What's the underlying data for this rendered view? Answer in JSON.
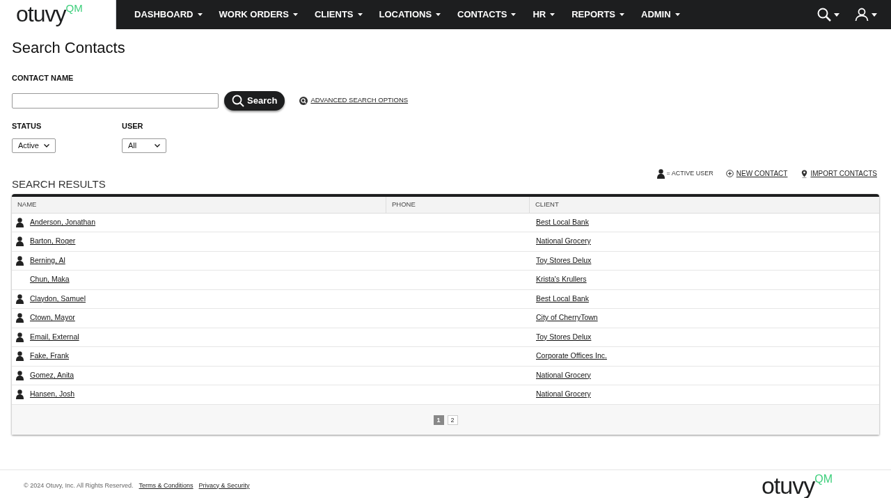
{
  "logo": {
    "word": "otuvy",
    "mark": "QM"
  },
  "nav": [
    {
      "label": "DASHBOARD"
    },
    {
      "label": "WORK ORDERS"
    },
    {
      "label": "CLIENTS"
    },
    {
      "label": "LOCATIONS"
    },
    {
      "label": "CONTACTS"
    },
    {
      "label": "HR"
    },
    {
      "label": "REPORTS"
    },
    {
      "label": "ADMIN"
    }
  ],
  "page_title": "Search Contacts",
  "contact_name": {
    "label": "CONTACT NAME"
  },
  "search_button": "Search",
  "advanced_link": "ADVANCED SEARCH OPTIONS",
  "status": {
    "label": "STATUS",
    "value": "Active"
  },
  "user": {
    "label": "USER",
    "value": "All"
  },
  "legend": "= ACTIVE USER",
  "actions": [
    {
      "kind": "new",
      "label": "NEW CONTACT"
    },
    {
      "kind": "import",
      "label": "IMPORT CONTACTS"
    }
  ],
  "results_title": "SEARCH RESULTS",
  "table": {
    "columns": [
      "NAME",
      "PHONE",
      "CLIENT"
    ],
    "rows": [
      {
        "name": "Anderson, Jonathan",
        "client": "Best Local Bank",
        "active": true
      },
      {
        "name": "Barton, Roger",
        "client": "National Grocery",
        "active": true
      },
      {
        "name": "Berning, Al",
        "client": "Toy Stores Delux",
        "active": true
      },
      {
        "name": "Chun, Maka",
        "client": "Krista's Krullers",
        "active": false
      },
      {
        "name": "Claydon, Samuel",
        "client": "Best Local Bank",
        "active": true
      },
      {
        "name": "Ctown, Mayor",
        "client": "City of CherryTown",
        "active": true
      },
      {
        "name": "Email, External",
        "client": "Toy Stores Delux",
        "active": true
      },
      {
        "name": "Fake, Frank",
        "client": "Corporate Offices Inc.",
        "active": true
      },
      {
        "name": "Gomez, Anita",
        "client": "National Grocery",
        "active": true
      },
      {
        "name": "Hansen, Josh",
        "client": "National Grocery",
        "active": true
      }
    ]
  },
  "pages": [
    {
      "label": "1",
      "selected": true
    },
    {
      "label": "2",
      "selected": false
    }
  ],
  "footer": {
    "copyright": "© 2024 Otuvy, Inc. All Rights Reserved.",
    "links": [
      "Terms & Conditions",
      "Privacy & Security"
    ]
  },
  "footer_logo": {
    "word": "otuvy",
    "mark": "QM"
  }
}
